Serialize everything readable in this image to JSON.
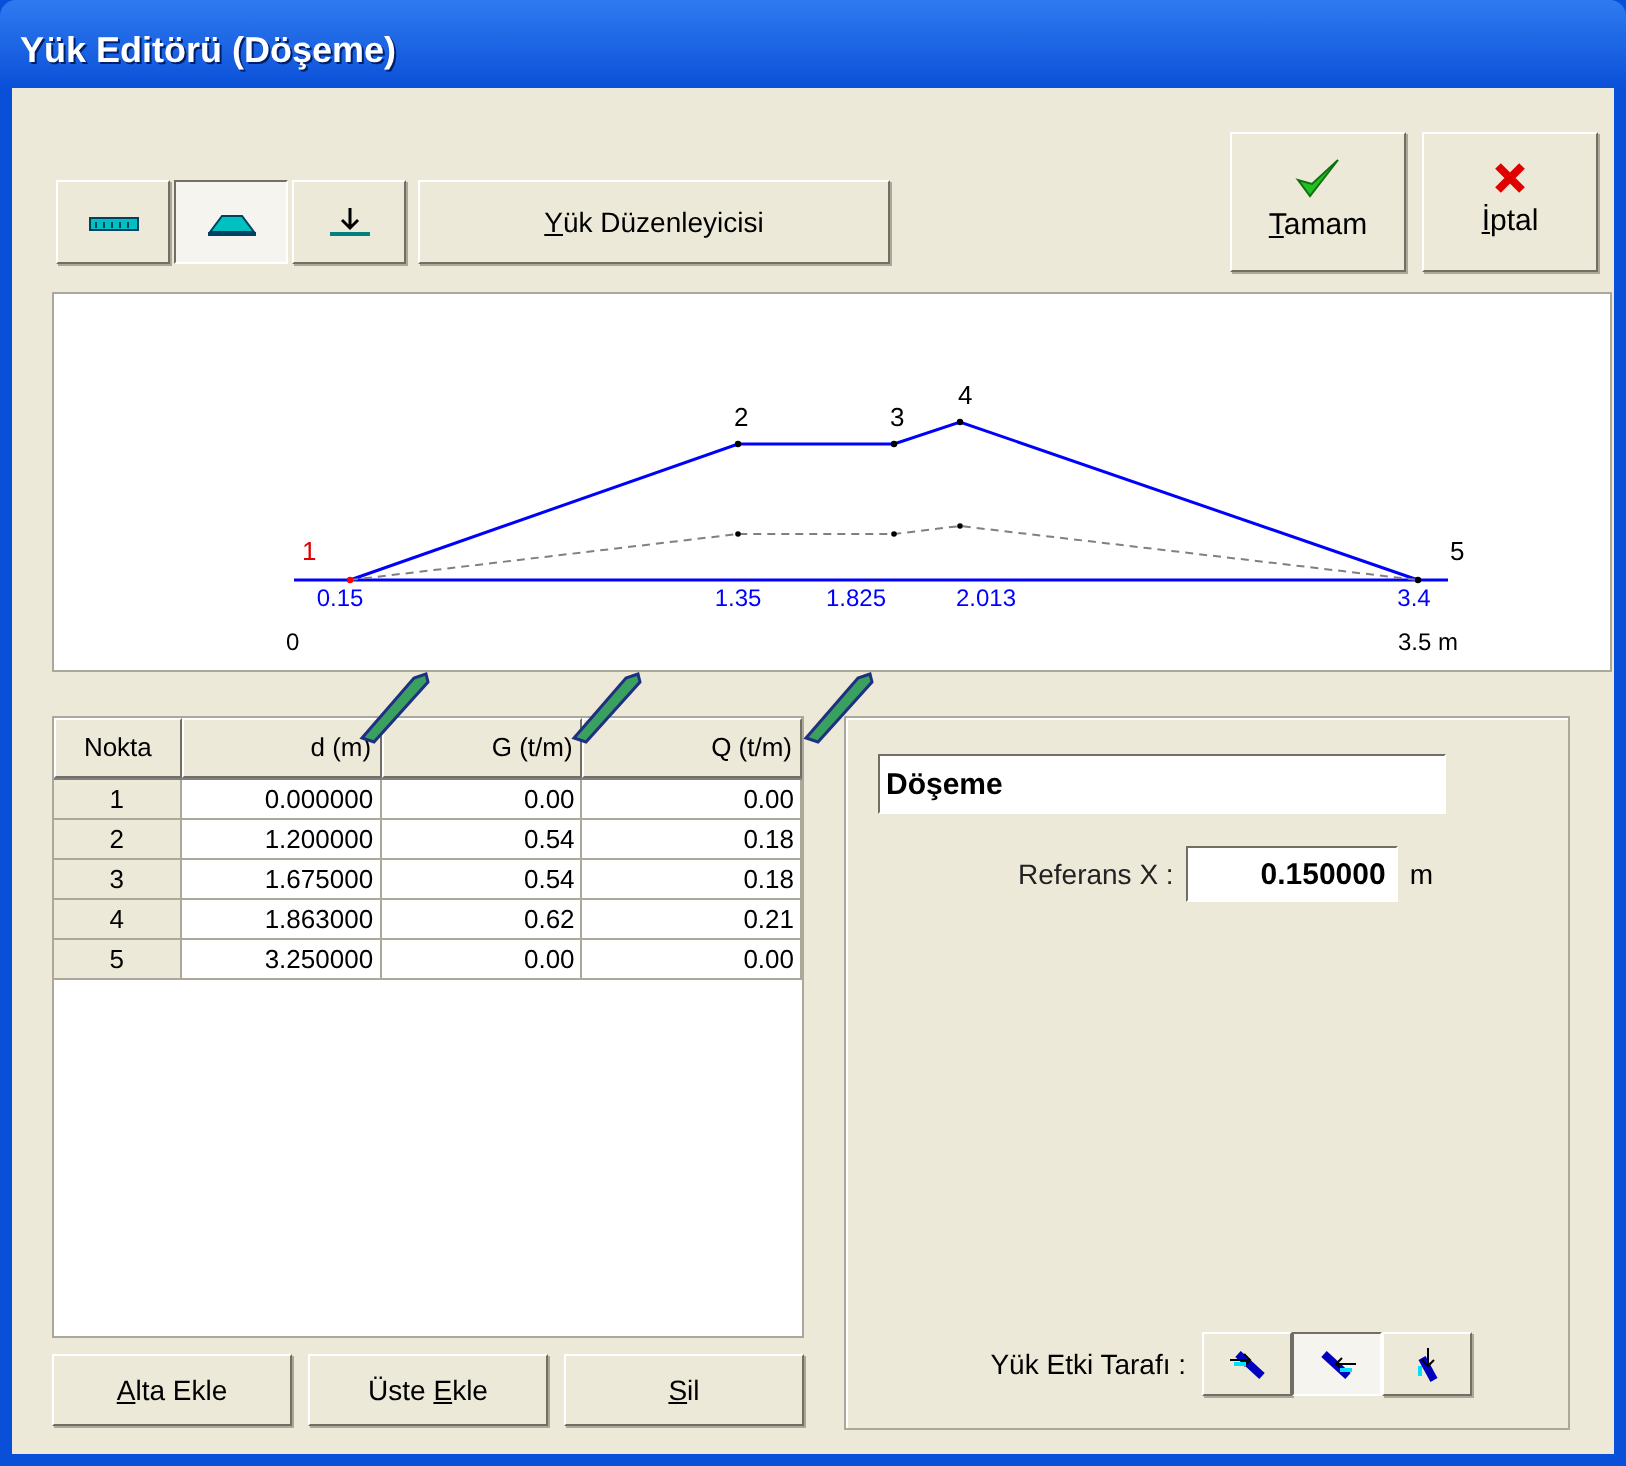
{
  "window": {
    "title": "Yük Editörü (Döşeme)"
  },
  "toolbar": {
    "modes": [
      {
        "kind": "uniform",
        "selected": false
      },
      {
        "kind": "trapezoid",
        "selected": true
      },
      {
        "kind": "point",
        "selected": false
      }
    ],
    "editor_button": {
      "key": "Y",
      "after": "ük Düzenleyicisi"
    }
  },
  "actions": [
    {
      "kind": "ok",
      "key": "T",
      "after": "amam"
    },
    {
      "kind": "cancel",
      "key": "İ",
      "after": "ptal"
    }
  ],
  "diagram": {
    "point_labels": [
      "1",
      "2",
      "3",
      "4",
      "5"
    ],
    "x_labels": [
      "0.15",
      "1.35",
      "1.825",
      "2.013",
      "3.4"
    ],
    "start": "0",
    "end": "3.5 m"
  },
  "table": {
    "columns": [
      "Nokta",
      "d (m)",
      "G (t/m)",
      "Q (t/m)"
    ],
    "rows": [
      [
        "1",
        "0.000000",
        "0.00",
        "0.00"
      ],
      [
        "2",
        "1.200000",
        "0.54",
        "0.18"
      ],
      [
        "3",
        "1.675000",
        "0.54",
        "0.18"
      ],
      [
        "4",
        "1.863000",
        "0.62",
        "0.21"
      ],
      [
        "5",
        "3.250000",
        "0.00",
        "0.00"
      ]
    ]
  },
  "table_buttons": [
    {
      "key": "A",
      "after": "lta Ekle"
    },
    {
      "before": "Üste ",
      "key": "E",
      "after": "kle"
    },
    {
      "key": "S",
      "after": "il"
    }
  ],
  "name_field": {
    "value": "Döşeme"
  },
  "reference": {
    "label": "Referans X :",
    "value": "0.150000",
    "unit": "m"
  },
  "load_side": {
    "label": "Yük Etki Tarafı :",
    "options": [
      {
        "kind": "right",
        "selected": false
      },
      {
        "kind": "left",
        "selected": true
      },
      {
        "kind": "down",
        "selected": false
      }
    ]
  }
}
